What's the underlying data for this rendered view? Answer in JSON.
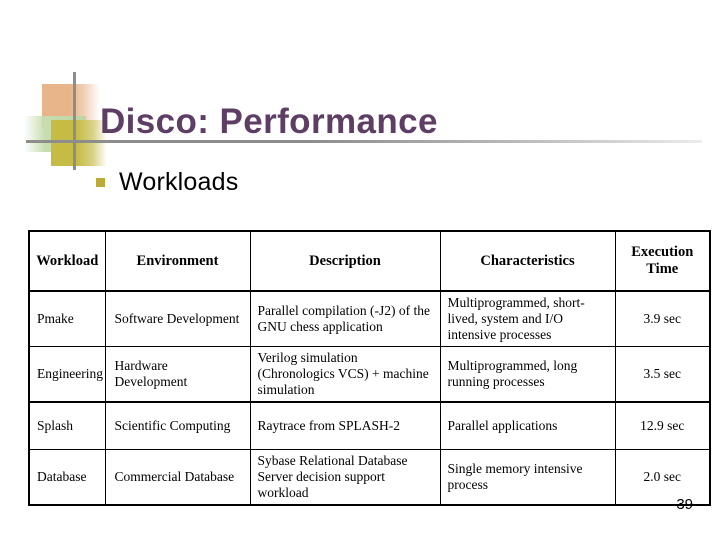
{
  "slide": {
    "title": "Disco: Performance",
    "bullet_label": "Workloads",
    "bullet_marker": "square-bullet",
    "slide_number": "39",
    "title_color": "#5f3e66",
    "bullet_color": "#bda83a",
    "rule_color": "#8d8d8d",
    "decoration": {
      "peach_color": "#e8b489",
      "green_color": "#c8dcaf",
      "olive_color": "#c6bb45",
      "line_color": "#8d8d8d"
    }
  },
  "table": {
    "headers": {
      "workload": "Workload",
      "environment": "Environment",
      "description": "Description",
      "characteristics": "Characteristics",
      "execution_time_line1": "Execution",
      "execution_time_line2": "Time"
    },
    "rows": [
      {
        "workload": "Pmake",
        "environment": "Software Development",
        "description": "Parallel compilation (-J2) of the GNU chess application",
        "characteristics": "Multiprogrammed, short-lived, system and I/O intensive processes",
        "execution_time": "3.9 sec"
      },
      {
        "workload": "Engineering",
        "environment": "Hardware Development",
        "description": "Verilog simulation (Chronologics VCS) + machine simulation",
        "characteristics": "Multiprogrammed, long running processes",
        "execution_time": "3.5 sec"
      },
      {
        "workload": "Splash",
        "environment": "Scientific Computing",
        "description": "Raytrace from SPLASH-2",
        "characteristics": "Parallel applications",
        "execution_time": "12.9 sec"
      },
      {
        "workload": "Database",
        "environment": "Commercial Database",
        "description": "Sybase Relational Database Server decision support workload",
        "characteristics": "Single memory intensive process",
        "execution_time": "2.0 sec"
      }
    ]
  }
}
